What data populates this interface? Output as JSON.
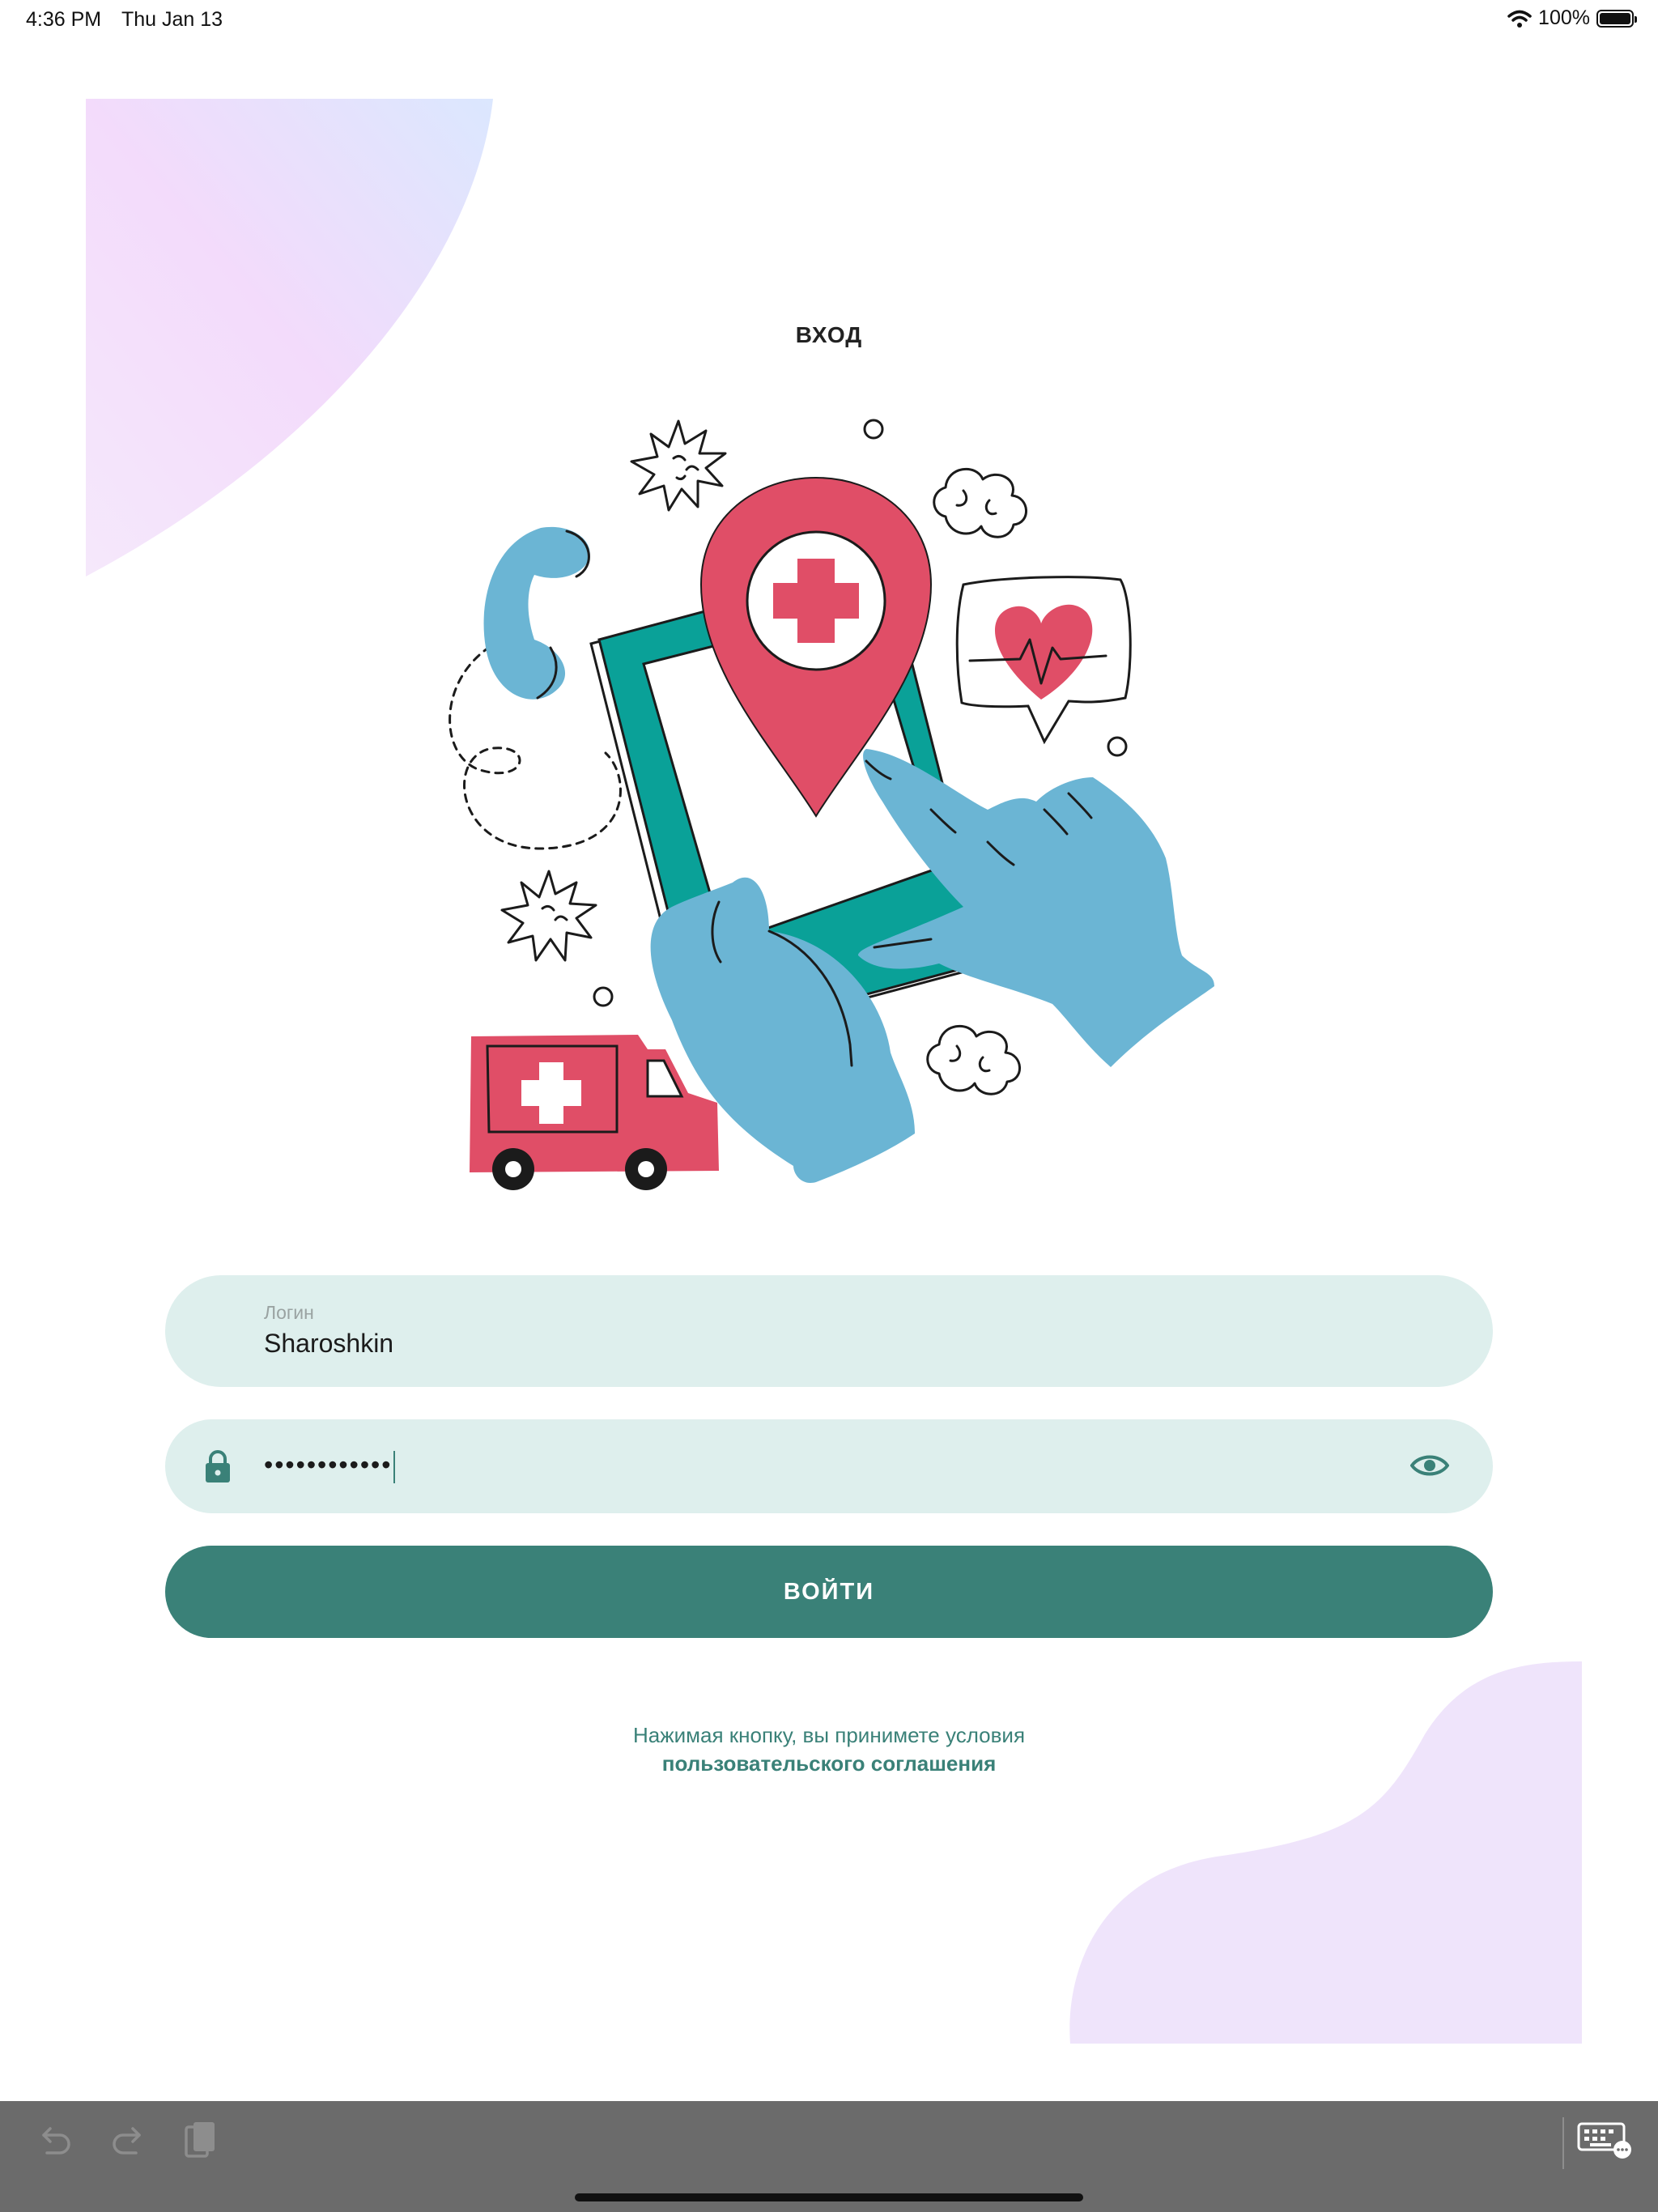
{
  "status_bar": {
    "time": "4:36 PM",
    "date": "Thu Jan 13",
    "battery": "100%",
    "icons": [
      "wifi-icon",
      "battery-icon"
    ]
  },
  "header": {
    "title": "ВХОД"
  },
  "login_field": {
    "label": "Логин",
    "value": "Sharoshkin"
  },
  "password_field": {
    "value": "••••••••••••",
    "icons": [
      "lock-icon",
      "eye-icon"
    ]
  },
  "login_button": {
    "label": "ВОЙТИ"
  },
  "terms": {
    "text": "Нажимая кнопку, вы принимете условия",
    "link": "пользовательского соглашения"
  },
  "keyboard_toolbar": {
    "icons": [
      "undo-icon",
      "redo-icon",
      "paste-icon",
      "keyboard-icon"
    ]
  },
  "colors": {
    "accent": "#3a8178",
    "field_bg": "#deefed",
    "pin_red": "#e04e67",
    "hand_blue": "#6bb5d4",
    "phone_teal": "#0aa198",
    "blob_lavender": "#efe4fb",
    "toolbar_gray": "#6b6b6b"
  }
}
